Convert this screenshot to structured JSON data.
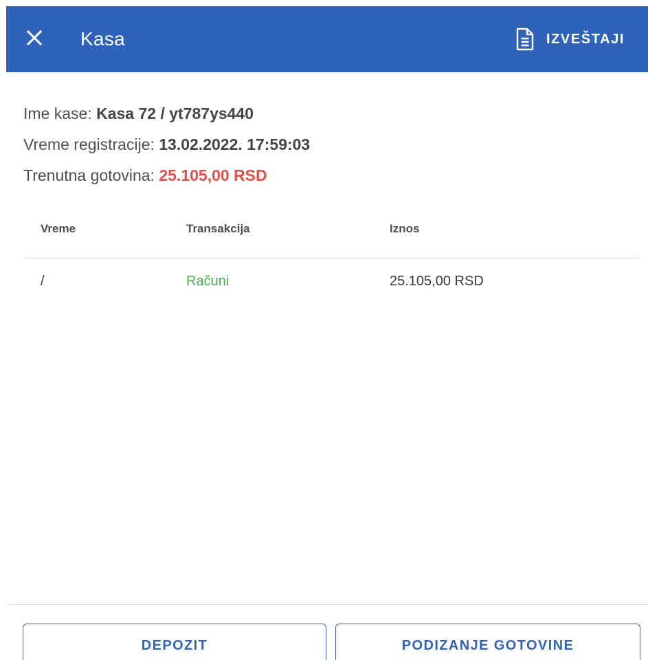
{
  "appbar": {
    "title": "Kasa",
    "close_icon": "close-icon",
    "reports_icon": "document-icon",
    "reports_label": "IZVEŠTAJI",
    "background": "#2f63b9"
  },
  "info": {
    "name_label": "Ime kase: ",
    "name_value": "Kasa 72 / yt787ys440",
    "registration_label": "Vreme registracije: ",
    "registration_value": "13.02.2022. 17:59:03",
    "cash_label": "Trenutna gotovina: ",
    "cash_value": "25.105,00 RSD",
    "cash_color": "#e0504a"
  },
  "table": {
    "headers": [
      "Vreme",
      "Transakcija",
      "Iznos"
    ],
    "rows": [
      {
        "time": "/",
        "transaction": "Računi",
        "amount": "25.105,00 RSD"
      }
    ],
    "link_color": "#4caf50"
  },
  "actions": {
    "deposit_label": "DEPOZIT",
    "withdraw_label": "PODIZANJE GOTOVINE"
  }
}
